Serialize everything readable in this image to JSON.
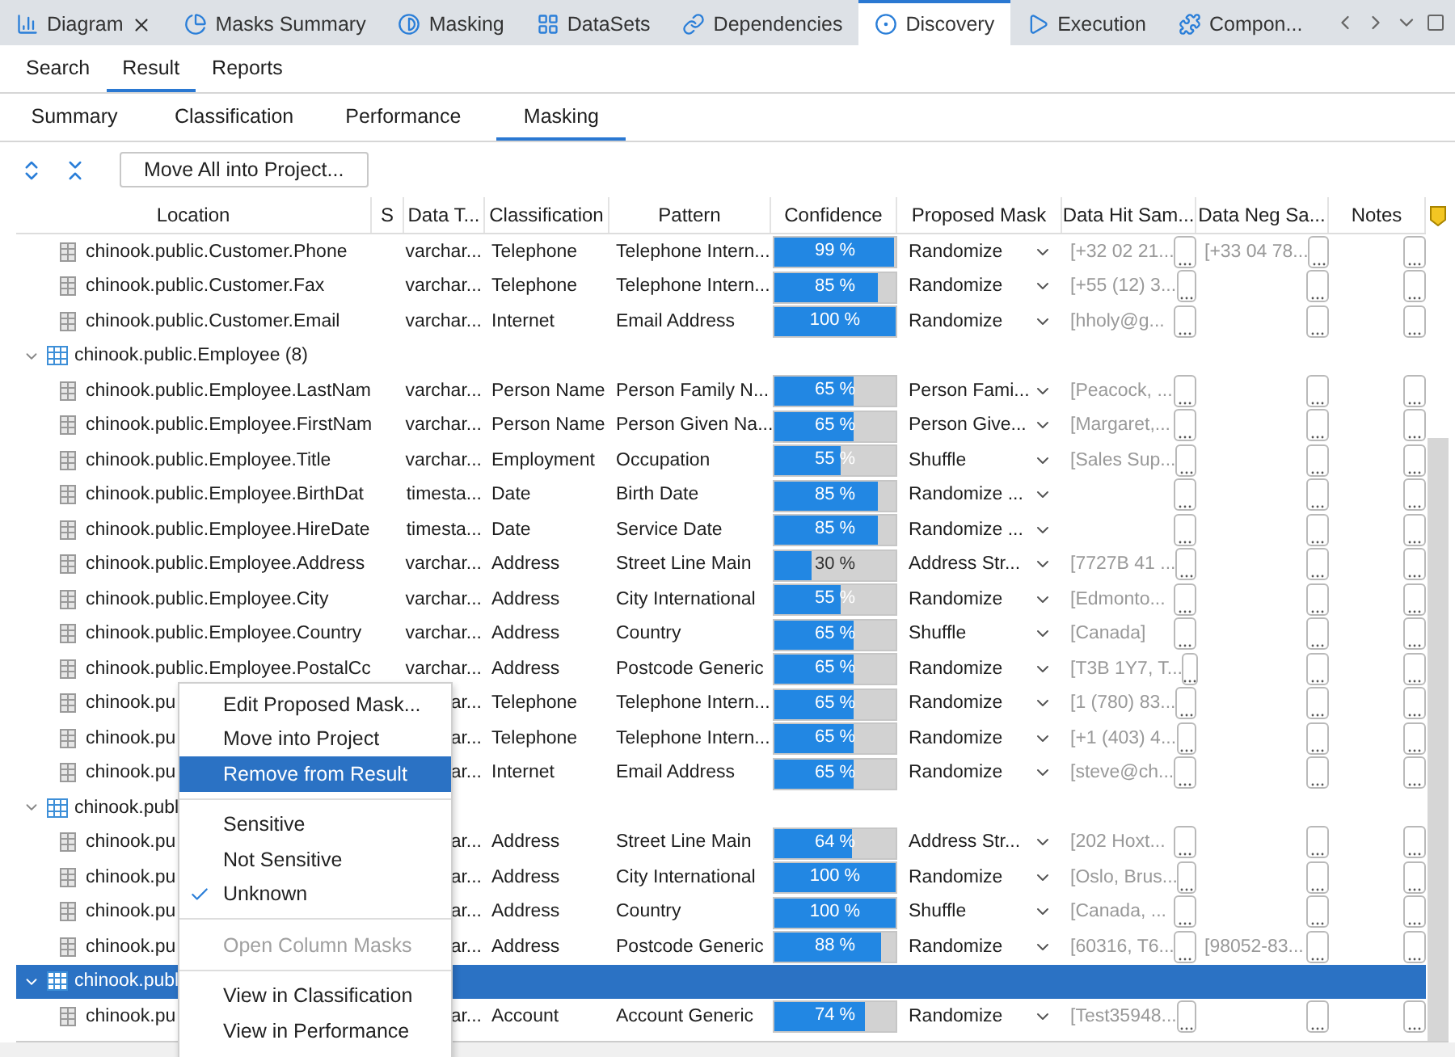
{
  "tabs": [
    {
      "label": "Diagram",
      "closable": true,
      "selected": false
    },
    {
      "label": "Masks Summary",
      "closable": false,
      "selected": false
    },
    {
      "label": "Masking",
      "closable": false,
      "selected": false
    },
    {
      "label": "DataSets",
      "closable": false,
      "selected": false
    },
    {
      "label": "Dependencies",
      "closable": false,
      "selected": false
    },
    {
      "label": "Discovery",
      "closable": false,
      "selected": true
    },
    {
      "label": "Execution",
      "closable": false,
      "selected": false
    },
    {
      "label": "Compon...",
      "closable": false,
      "selected": false
    }
  ],
  "view_tabs": [
    {
      "label": "Search",
      "selected": false
    },
    {
      "label": "Result",
      "selected": true
    },
    {
      "label": "Reports",
      "selected": false
    }
  ],
  "result_tabs": [
    {
      "label": "Summary",
      "selected": false
    },
    {
      "label": "Classification",
      "selected": false
    },
    {
      "label": "Performance",
      "selected": false
    },
    {
      "label": "Masking",
      "selected": true
    }
  ],
  "toolbar": {
    "button": "Move All into Project..."
  },
  "table": {
    "columns": [
      "Location",
      "S",
      "Data T...",
      "Classification",
      "Pattern",
      "Confidence",
      "Proposed Mask",
      "Data Hit Sam...",
      "Data Neg Sa...",
      "Notes"
    ],
    "tree": [
      {
        "kind": "column",
        "location": "chinook.public.Customer.Phone",
        "data_type": "varchar...",
        "classification": "Telephone",
        "pattern": "Telephone Intern...",
        "level": 0.99,
        "confidence": "99 %",
        "proposed_mask": "Randomize",
        "hit_sample": "[+32 02 21...",
        "neg_sample": "[+33 04 78..."
      },
      {
        "kind": "column",
        "location": "chinook.public.Customer.Fax",
        "data_type": "varchar...",
        "classification": "Telephone",
        "pattern": "Telephone Intern...",
        "level": 0.85,
        "confidence": "85 %",
        "proposed_mask": "Randomize",
        "hit_sample": "[+55 (12) 3..."
      },
      {
        "kind": "column",
        "location": "chinook.public.Customer.Email",
        "data_type": "varchar...",
        "classification": "Internet",
        "pattern": "Email Address",
        "level": 1.0,
        "confidence": "100 %",
        "proposed_mask": "Randomize",
        "hit_sample": "[hholy@g..."
      },
      {
        "kind": "group",
        "location": "chinook.public.Employee (8)",
        "expanded": true,
        "selected": false,
        "children": [
          {
            "kind": "column",
            "location": "chinook.public.Employee.LastNam",
            "data_type": "varchar...",
            "classification": "Person Name",
            "pattern": "Person Family N...",
            "level": 0.65,
            "confidence": "65 %",
            "proposed_mask": "Person Fami...",
            "hit_sample": "[Peacock, ..."
          },
          {
            "kind": "column",
            "location": "chinook.public.Employee.FirstNam",
            "data_type": "varchar...",
            "classification": "Person Name",
            "pattern": "Person Given Na...",
            "level": 0.65,
            "confidence": "65 %",
            "proposed_mask": "Person Give...",
            "hit_sample": "[Margaret,..."
          },
          {
            "kind": "column",
            "location": "chinook.public.Employee.Title",
            "data_type": "varchar...",
            "classification": "Employment",
            "pattern": "Occupation",
            "level": 0.55,
            "confidence": "55 %",
            "proposed_mask": "Shuffle",
            "hit_sample": "[Sales Sup..."
          },
          {
            "kind": "column",
            "location": "chinook.public.Employee.BirthDat",
            "data_type": "timesta...",
            "classification": "Date",
            "pattern": "Birth Date",
            "level": 0.85,
            "confidence": "85 %",
            "proposed_mask": "Randomize ..."
          },
          {
            "kind": "column",
            "location": "chinook.public.Employee.HireDate",
            "data_type": "timesta...",
            "classification": "Date",
            "pattern": "Service Date",
            "level": 0.85,
            "confidence": "85 %",
            "proposed_mask": "Randomize ..."
          },
          {
            "kind": "column",
            "location": "chinook.public.Employee.Address",
            "data_type": "varchar...",
            "classification": "Address",
            "pattern": "Street Line Main",
            "level": 0.3,
            "confidence": "30 %",
            "proposed_mask": "Address Str...",
            "hit_sample": "[7727B 41 ..."
          },
          {
            "kind": "column",
            "location": "chinook.public.Employee.City",
            "data_type": "varchar...",
            "classification": "Address",
            "pattern": "City International",
            "level": 0.55,
            "confidence": "55 %",
            "proposed_mask": "Randomize",
            "hit_sample": "[Edmonto..."
          },
          {
            "kind": "column",
            "location": "chinook.public.Employee.Country",
            "data_type": "varchar...",
            "classification": "Address",
            "pattern": "Country",
            "level": 0.65,
            "confidence": "65 %",
            "proposed_mask": "Shuffle",
            "hit_sample": "[Canada]"
          },
          {
            "kind": "column",
            "location": "chinook.public.Employee.PostalCc",
            "data_type": "varchar...",
            "classification": "Address",
            "pattern": "Postcode Generic",
            "level": 0.65,
            "confidence": "65 %",
            "proposed_mask": "Randomize",
            "hit_sample": "[T3B 1Y7, T..."
          },
          {
            "kind": "column",
            "location": "chinook.pu",
            "data_type": "ar...",
            "classification": "Telephone",
            "pattern": "Telephone Intern...",
            "level": 0.65,
            "confidence": "65 %",
            "proposed_mask": "Randomize",
            "hit_sample": "[1 (780) 83..."
          },
          {
            "kind": "column",
            "location": "chinook.pu",
            "data_type": "ar...",
            "classification": "Telephone",
            "pattern": "Telephone Intern...",
            "level": 0.65,
            "confidence": "65 %",
            "proposed_mask": "Randomize",
            "hit_sample": "[+1 (403) 4..."
          },
          {
            "kind": "column",
            "location": "chinook.pu",
            "data_type": "ar...",
            "classification": "Internet",
            "pattern": "Email Address",
            "level": 0.65,
            "confidence": "65 %",
            "proposed_mask": "Randomize",
            "hit_sample": "[steve@ch..."
          }
        ]
      },
      {
        "kind": "group",
        "location": "chinook.publ",
        "expanded": true,
        "selected": false,
        "children": [
          {
            "kind": "column",
            "location": "chinook.pu",
            "data_type": "ar...",
            "classification": "Address",
            "pattern": "Street Line Main",
            "level": 0.64,
            "confidence": "64 %",
            "proposed_mask": "Address Str...",
            "hit_sample": "[202 Hoxt..."
          },
          {
            "kind": "column",
            "location": "chinook.pu",
            "data_type": "ar...",
            "classification": "Address",
            "pattern": "City International",
            "level": 1.0,
            "confidence": "100 %",
            "proposed_mask": "Randomize",
            "hit_sample": "[Oslo, Brus..."
          },
          {
            "kind": "column",
            "location": "chinook.pu",
            "data_type": "ar...",
            "classification": "Address",
            "pattern": "Country",
            "level": 1.0,
            "confidence": "100 %",
            "proposed_mask": "Shuffle",
            "hit_sample": "[Canada, ..."
          },
          {
            "kind": "column",
            "location": "chinook.pu",
            "data_type": "ar...",
            "classification": "Address",
            "pattern": "Postcode Generic",
            "level": 0.88,
            "confidence": "88 %",
            "proposed_mask": "Randomize",
            "hit_sample": "[60316, T6...",
            "neg_sample": "[98052-83..."
          }
        ]
      },
      {
        "kind": "group",
        "location": "chinook.publ",
        "expanded": true,
        "selected": true,
        "children": [
          {
            "kind": "column",
            "location": "chinook.pu",
            "data_type": "ar...",
            "classification": "Account",
            "pattern": "Account Generic",
            "level": 0.74,
            "confidence": "74 %",
            "proposed_mask": "Randomize",
            "hit_sample": "[Test35948..."
          }
        ]
      }
    ]
  },
  "context_menu": [
    {
      "kind": "item",
      "label": "Edit Proposed Mask...",
      "selected": false,
      "checked": false,
      "disabled": false
    },
    {
      "kind": "item",
      "label": "Move into Project",
      "selected": false,
      "checked": false,
      "disabled": false
    },
    {
      "kind": "item",
      "label": "Remove from Result",
      "selected": true,
      "checked": false,
      "disabled": false
    },
    {
      "kind": "separator"
    },
    {
      "kind": "item",
      "label": "Sensitive",
      "selected": false,
      "checked": false,
      "disabled": false
    },
    {
      "kind": "item",
      "label": "Not Sensitive",
      "selected": false,
      "checked": false,
      "disabled": false
    },
    {
      "kind": "item",
      "label": "Unknown",
      "selected": false,
      "checked": true,
      "disabled": false
    },
    {
      "kind": "separator"
    },
    {
      "kind": "item",
      "label": "Open Column Masks",
      "selected": false,
      "checked": false,
      "disabled": true
    },
    {
      "kind": "separator"
    },
    {
      "kind": "item",
      "label": "View in Classification",
      "selected": false,
      "checked": false,
      "disabled": false
    },
    {
      "kind": "item",
      "label": "View in Performance",
      "selected": false,
      "checked": false,
      "disabled": false
    }
  ]
}
